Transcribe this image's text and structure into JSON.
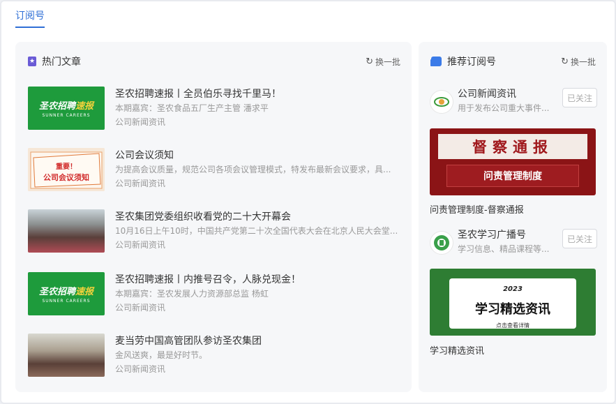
{
  "tab": {
    "label": "订阅号"
  },
  "hot": {
    "title": "热门文章",
    "refresh": "换一批",
    "articles": [
      {
        "title": "圣农招聘速报丨全员伯乐寻找千里马！",
        "desc": "本期嘉宾：圣农食品五厂生产主管 潘求平",
        "source": "公司新闻资讯",
        "img_big": "圣农招聘",
        "img_big_y": "速报",
        "img_small": "SUNNER CAREERS"
      },
      {
        "title": "公司会议须知",
        "desc": "为提高会议质量，规范公司各项会议管理模式，特发布最新会议要求，具...",
        "source": "公司新闻资讯",
        "img_text": "重要！公司会议须知"
      },
      {
        "title": "圣农集团党委组织收看党的二十大开幕会",
        "desc": "10月16日上午10时，中国共产党第二十次全国代表大会在北京人民大会堂...",
        "source": "公司新闻资讯"
      },
      {
        "title": "圣农招聘速报丨内推号召令，人脉兑现金！",
        "desc": "本期嘉宾：圣农发展人力资源部总监 杨虹",
        "source": "公司新闻资讯",
        "img_big": "圣农招聘",
        "img_big_y": "速报",
        "img_small": "SUNNER CAREERS"
      },
      {
        "title": "麦当劳中国高管团队参访圣农集团",
        "desc": "金风送爽，最是好时节。",
        "source": "公司新闻资讯"
      }
    ]
  },
  "recommend": {
    "title": "推荐订阅号",
    "refresh": "换一批",
    "subs": [
      {
        "name": "公司新闻资讯",
        "desc": "用于发布公司重大事件...",
        "follow": "已关注"
      },
      {
        "name": "圣农学习广播号",
        "desc": "学习信息、精品课程等...",
        "follow": "已关注"
      }
    ],
    "banners": [
      {
        "top": "督察通报",
        "band": "问责管理制度",
        "caption": "问责管理制度-督察通报"
      },
      {
        "year": "2023",
        "main": "学习精选资讯",
        "hint": "点击查看详情",
        "caption": "学习精选资讯"
      }
    ]
  },
  "colors": {
    "accent": "#2f6fd6",
    "brand_green": "#1e9b3c",
    "alert_red": "#8b1416"
  }
}
